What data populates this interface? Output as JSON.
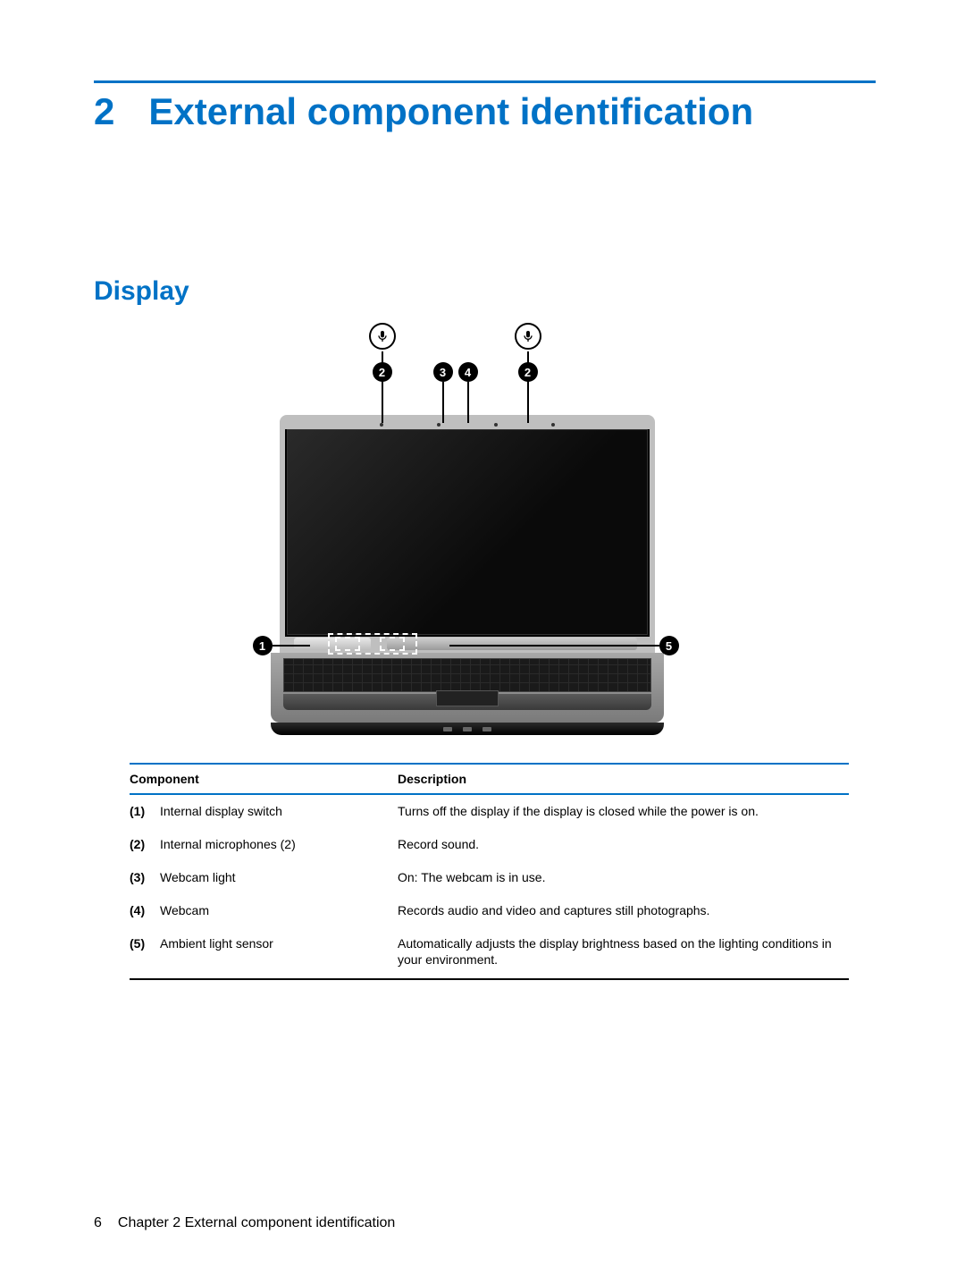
{
  "chapter": {
    "number": "2",
    "title": "External component identification"
  },
  "section": {
    "title": "Display"
  },
  "callouts": {
    "c1": "1",
    "c2": "2",
    "c3": "3",
    "c4": "4",
    "c5": "5"
  },
  "table": {
    "headers": {
      "component": "Component",
      "description": "Description"
    },
    "rows": [
      {
        "num": "(1)",
        "name": "Internal display switch",
        "desc": "Turns off the display if the display is closed while the power is on."
      },
      {
        "num": "(2)",
        "name": "Internal microphones (2)",
        "desc": "Record sound."
      },
      {
        "num": "(3)",
        "name": "Webcam light",
        "desc": "On: The webcam is in use."
      },
      {
        "num": "(4)",
        "name": "Webcam",
        "desc": "Records audio and video and captures still photographs."
      },
      {
        "num": "(5)",
        "name": "Ambient light sensor",
        "desc": "Automatically adjusts the display brightness based on the lighting conditions in your environment."
      }
    ]
  },
  "footer": {
    "page": "6",
    "text": "Chapter 2   External component identification"
  },
  "icons": {
    "mic": "microphone-icon"
  }
}
